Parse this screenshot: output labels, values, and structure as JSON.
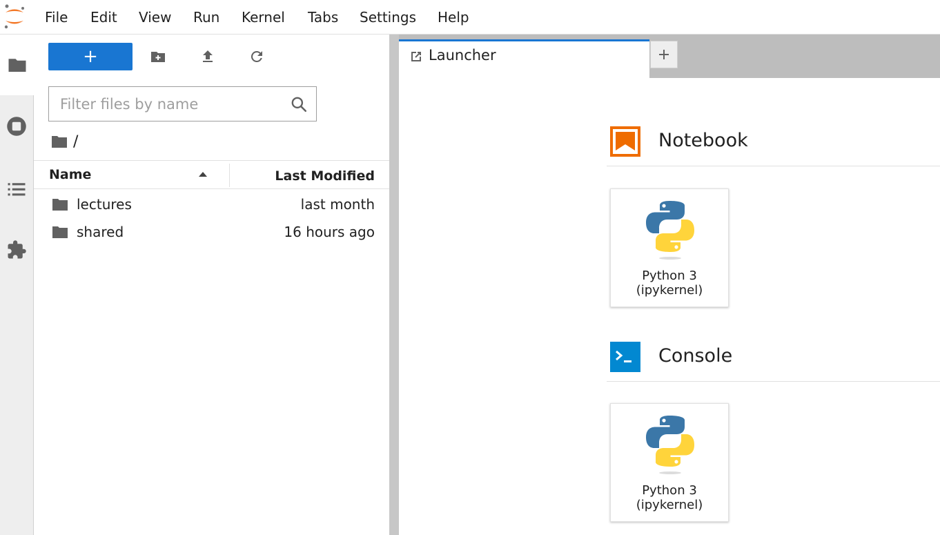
{
  "menu": {
    "items": [
      "File",
      "Edit",
      "View",
      "Run",
      "Kernel",
      "Tabs",
      "Settings",
      "Help"
    ]
  },
  "activitybar": {
    "tabs": [
      {
        "icon": "folder-icon",
        "active": true
      },
      {
        "icon": "running-icon",
        "active": false
      },
      {
        "icon": "toc-icon",
        "active": false
      },
      {
        "icon": "extension-icon",
        "active": false
      }
    ]
  },
  "filebrowser": {
    "new_label": "+",
    "filter_placeholder": "Filter files by name",
    "path": "/",
    "columns": {
      "name": "Name",
      "modified": "Last Modified"
    },
    "files": [
      {
        "name": "lectures",
        "modified": "last month",
        "type": "folder"
      },
      {
        "name": "shared",
        "modified": "16 hours ago",
        "type": "folder"
      }
    ]
  },
  "tabs": [
    {
      "label": "Launcher",
      "icon": "launcher-icon",
      "active": true
    }
  ],
  "launcher": {
    "sections": [
      {
        "title": "Notebook",
        "icon": "notebook-icon",
        "cards": [
          {
            "label_line1": "Python 3",
            "label_line2": "(ipykernel)"
          }
        ]
      },
      {
        "title": "Console",
        "icon": "console-icon",
        "cards": [
          {
            "label_line1": "Python 3",
            "label_line2": "(ipykernel)"
          }
        ]
      }
    ]
  },
  "colors": {
    "accent": "#1976d2",
    "logo_orange": "#f37726",
    "notebook_orange": "#ef6c00",
    "console_blue": "#0288d1",
    "python_blue": "#3b77a8",
    "python_yellow": "#ffd43b"
  }
}
